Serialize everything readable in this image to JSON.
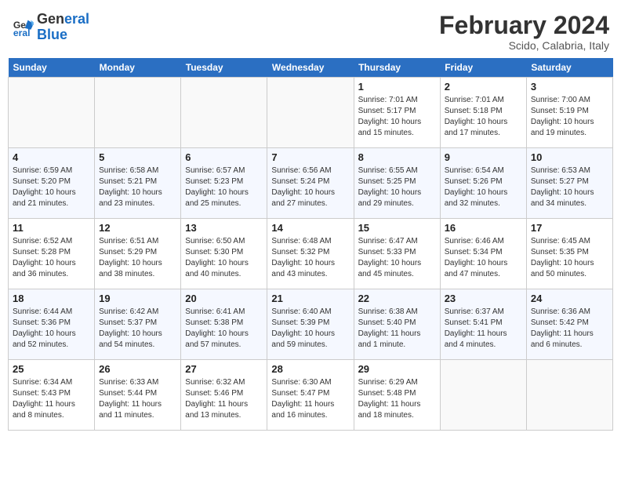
{
  "header": {
    "logo_general": "General",
    "logo_blue": "Blue",
    "month_year": "February 2024",
    "location": "Scido, Calabria, Italy"
  },
  "days_of_week": [
    "Sunday",
    "Monday",
    "Tuesday",
    "Wednesday",
    "Thursday",
    "Friday",
    "Saturday"
  ],
  "weeks": [
    [
      {
        "day": "",
        "info": "",
        "empty": true
      },
      {
        "day": "",
        "info": "",
        "empty": true
      },
      {
        "day": "",
        "info": "",
        "empty": true
      },
      {
        "day": "",
        "info": "",
        "empty": true
      },
      {
        "day": "1",
        "info": "Sunrise: 7:01 AM\nSunset: 5:17 PM\nDaylight: 10 hours\nand 15 minutes."
      },
      {
        "day": "2",
        "info": "Sunrise: 7:01 AM\nSunset: 5:18 PM\nDaylight: 10 hours\nand 17 minutes."
      },
      {
        "day": "3",
        "info": "Sunrise: 7:00 AM\nSunset: 5:19 PM\nDaylight: 10 hours\nand 19 minutes."
      }
    ],
    [
      {
        "day": "4",
        "info": "Sunrise: 6:59 AM\nSunset: 5:20 PM\nDaylight: 10 hours\nand 21 minutes."
      },
      {
        "day": "5",
        "info": "Sunrise: 6:58 AM\nSunset: 5:21 PM\nDaylight: 10 hours\nand 23 minutes."
      },
      {
        "day": "6",
        "info": "Sunrise: 6:57 AM\nSunset: 5:23 PM\nDaylight: 10 hours\nand 25 minutes."
      },
      {
        "day": "7",
        "info": "Sunrise: 6:56 AM\nSunset: 5:24 PM\nDaylight: 10 hours\nand 27 minutes."
      },
      {
        "day": "8",
        "info": "Sunrise: 6:55 AM\nSunset: 5:25 PM\nDaylight: 10 hours\nand 29 minutes."
      },
      {
        "day": "9",
        "info": "Sunrise: 6:54 AM\nSunset: 5:26 PM\nDaylight: 10 hours\nand 32 minutes."
      },
      {
        "day": "10",
        "info": "Sunrise: 6:53 AM\nSunset: 5:27 PM\nDaylight: 10 hours\nand 34 minutes."
      }
    ],
    [
      {
        "day": "11",
        "info": "Sunrise: 6:52 AM\nSunset: 5:28 PM\nDaylight: 10 hours\nand 36 minutes."
      },
      {
        "day": "12",
        "info": "Sunrise: 6:51 AM\nSunset: 5:29 PM\nDaylight: 10 hours\nand 38 minutes."
      },
      {
        "day": "13",
        "info": "Sunrise: 6:50 AM\nSunset: 5:30 PM\nDaylight: 10 hours\nand 40 minutes."
      },
      {
        "day": "14",
        "info": "Sunrise: 6:48 AM\nSunset: 5:32 PM\nDaylight: 10 hours\nand 43 minutes."
      },
      {
        "day": "15",
        "info": "Sunrise: 6:47 AM\nSunset: 5:33 PM\nDaylight: 10 hours\nand 45 minutes."
      },
      {
        "day": "16",
        "info": "Sunrise: 6:46 AM\nSunset: 5:34 PM\nDaylight: 10 hours\nand 47 minutes."
      },
      {
        "day": "17",
        "info": "Sunrise: 6:45 AM\nSunset: 5:35 PM\nDaylight: 10 hours\nand 50 minutes."
      }
    ],
    [
      {
        "day": "18",
        "info": "Sunrise: 6:44 AM\nSunset: 5:36 PM\nDaylight: 10 hours\nand 52 minutes."
      },
      {
        "day": "19",
        "info": "Sunrise: 6:42 AM\nSunset: 5:37 PM\nDaylight: 10 hours\nand 54 minutes."
      },
      {
        "day": "20",
        "info": "Sunrise: 6:41 AM\nSunset: 5:38 PM\nDaylight: 10 hours\nand 57 minutes."
      },
      {
        "day": "21",
        "info": "Sunrise: 6:40 AM\nSunset: 5:39 PM\nDaylight: 10 hours\nand 59 minutes."
      },
      {
        "day": "22",
        "info": "Sunrise: 6:38 AM\nSunset: 5:40 PM\nDaylight: 11 hours\nand 1 minute."
      },
      {
        "day": "23",
        "info": "Sunrise: 6:37 AM\nSunset: 5:41 PM\nDaylight: 11 hours\nand 4 minutes."
      },
      {
        "day": "24",
        "info": "Sunrise: 6:36 AM\nSunset: 5:42 PM\nDaylight: 11 hours\nand 6 minutes."
      }
    ],
    [
      {
        "day": "25",
        "info": "Sunrise: 6:34 AM\nSunset: 5:43 PM\nDaylight: 11 hours\nand 8 minutes."
      },
      {
        "day": "26",
        "info": "Sunrise: 6:33 AM\nSunset: 5:44 PM\nDaylight: 11 hours\nand 11 minutes."
      },
      {
        "day": "27",
        "info": "Sunrise: 6:32 AM\nSunset: 5:46 PM\nDaylight: 11 hours\nand 13 minutes."
      },
      {
        "day": "28",
        "info": "Sunrise: 6:30 AM\nSunset: 5:47 PM\nDaylight: 11 hours\nand 16 minutes."
      },
      {
        "day": "29",
        "info": "Sunrise: 6:29 AM\nSunset: 5:48 PM\nDaylight: 11 hours\nand 18 minutes."
      },
      {
        "day": "",
        "info": "",
        "empty": true
      },
      {
        "day": "",
        "info": "",
        "empty": true
      }
    ]
  ]
}
